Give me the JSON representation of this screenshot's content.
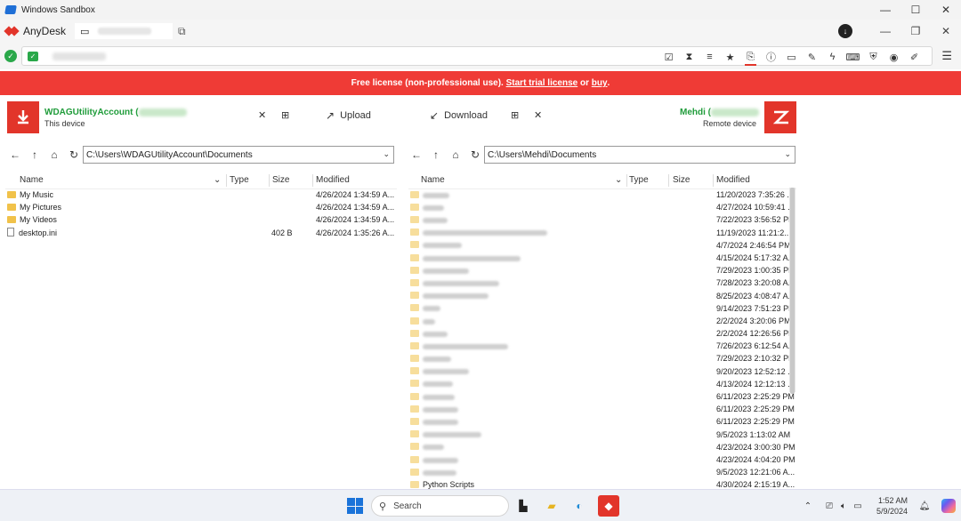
{
  "window": {
    "title": "Windows Sandbox",
    "controls": {
      "minimize": "—",
      "maximize": "☐",
      "close": "✕"
    }
  },
  "anydesk": {
    "app_name": "AnyDesk",
    "window_controls": {
      "minimize": "—",
      "restore": "❐",
      "close": "✕"
    }
  },
  "banner": {
    "text_prefix": "Free license (non-professional use). ",
    "trial_link": "Start trial license",
    "or": " or ",
    "buy_link": "buy",
    "suffix": "."
  },
  "local": {
    "device_name": "WDAGUtilityAccount (",
    "device_sub": "This device",
    "upload_label": "Upload",
    "path": "C:\\Users\\WDAGUtilityAccount\\Documents",
    "columns": {
      "name": "Name",
      "type": "Type",
      "size": "Size",
      "modified": "Modified"
    },
    "files": [
      {
        "name": "My Music",
        "kind": "folder",
        "size": "",
        "modified": "4/26/2024 1:34:59 A..."
      },
      {
        "name": "My Pictures",
        "kind": "folder",
        "size": "",
        "modified": "4/26/2024 1:34:59 A..."
      },
      {
        "name": "My Videos",
        "kind": "folder",
        "size": "",
        "modified": "4/26/2024 1:34:59 A..."
      },
      {
        "name": "desktop.ini",
        "kind": "file",
        "size": "402 B",
        "modified": "4/26/2024 1:35:26 A..."
      }
    ]
  },
  "remote": {
    "device_name": "Mehdi (",
    "device_sub": "Remote device",
    "download_label": "Download",
    "path": "C:\\Users\\Mehdi\\Documents",
    "columns": {
      "name": "Name",
      "type": "Type",
      "size": "Size",
      "modified": "Modified"
    },
    "files": [
      {
        "name": "",
        "modified": "11/20/2023 7:35:26 ..."
      },
      {
        "name": "",
        "modified": "4/27/2024 10:59:41 ..."
      },
      {
        "name": "",
        "modified": "7/22/2023 3:56:52 PM"
      },
      {
        "name": "",
        "modified": "11/19/2023 11:21:2..."
      },
      {
        "name": "",
        "modified": "4/7/2024 2:46:54 PM"
      },
      {
        "name": "",
        "modified": "4/15/2024 5:17:32 A..."
      },
      {
        "name": "",
        "modified": "7/29/2023 1:00:35 PM"
      },
      {
        "name": "",
        "modified": "7/28/2023 3:20:08 A..."
      },
      {
        "name": "",
        "modified": "8/25/2023 4:08:47 A..."
      },
      {
        "name": "",
        "modified": "9/14/2023 7:51:23 PM"
      },
      {
        "name": "",
        "modified": "2/2/2024 3:20:06 PM"
      },
      {
        "name": "",
        "modified": "2/2/2024 12:26:56 PM"
      },
      {
        "name": "",
        "modified": "7/26/2023 6:12:54 A..."
      },
      {
        "name": "",
        "modified": "7/29/2023 2:10:32 PM"
      },
      {
        "name": "",
        "modified": "9/20/2023 12:52:12 ..."
      },
      {
        "name": "",
        "modified": "4/13/2024 12:12:13 ..."
      },
      {
        "name": "",
        "modified": "6/11/2023 2:25:29 PM"
      },
      {
        "name": "",
        "modified": "6/11/2023 2:25:29 PM"
      },
      {
        "name": "",
        "modified": "6/11/2023 2:25:29 PM"
      },
      {
        "name": "",
        "modified": "9/5/2023 1:13:02 AM"
      },
      {
        "name": "",
        "modified": "4/23/2024 3:00:30 PM"
      },
      {
        "name": "",
        "modified": "4/23/2024 4:04:20 PM"
      },
      {
        "name": "",
        "modified": "9/5/2023 12:21:06 A..."
      },
      {
        "name": "Python Scripts",
        "modified": "4/30/2024 2:15:19 A..."
      }
    ]
  },
  "taskbar": {
    "search_placeholder": "Search",
    "time": "1:52 AM",
    "date": "5/9/2024"
  },
  "colors": {
    "accent": "#ef3b36",
    "device_green": "#1f9c3a",
    "folder": "#f1c24a"
  }
}
